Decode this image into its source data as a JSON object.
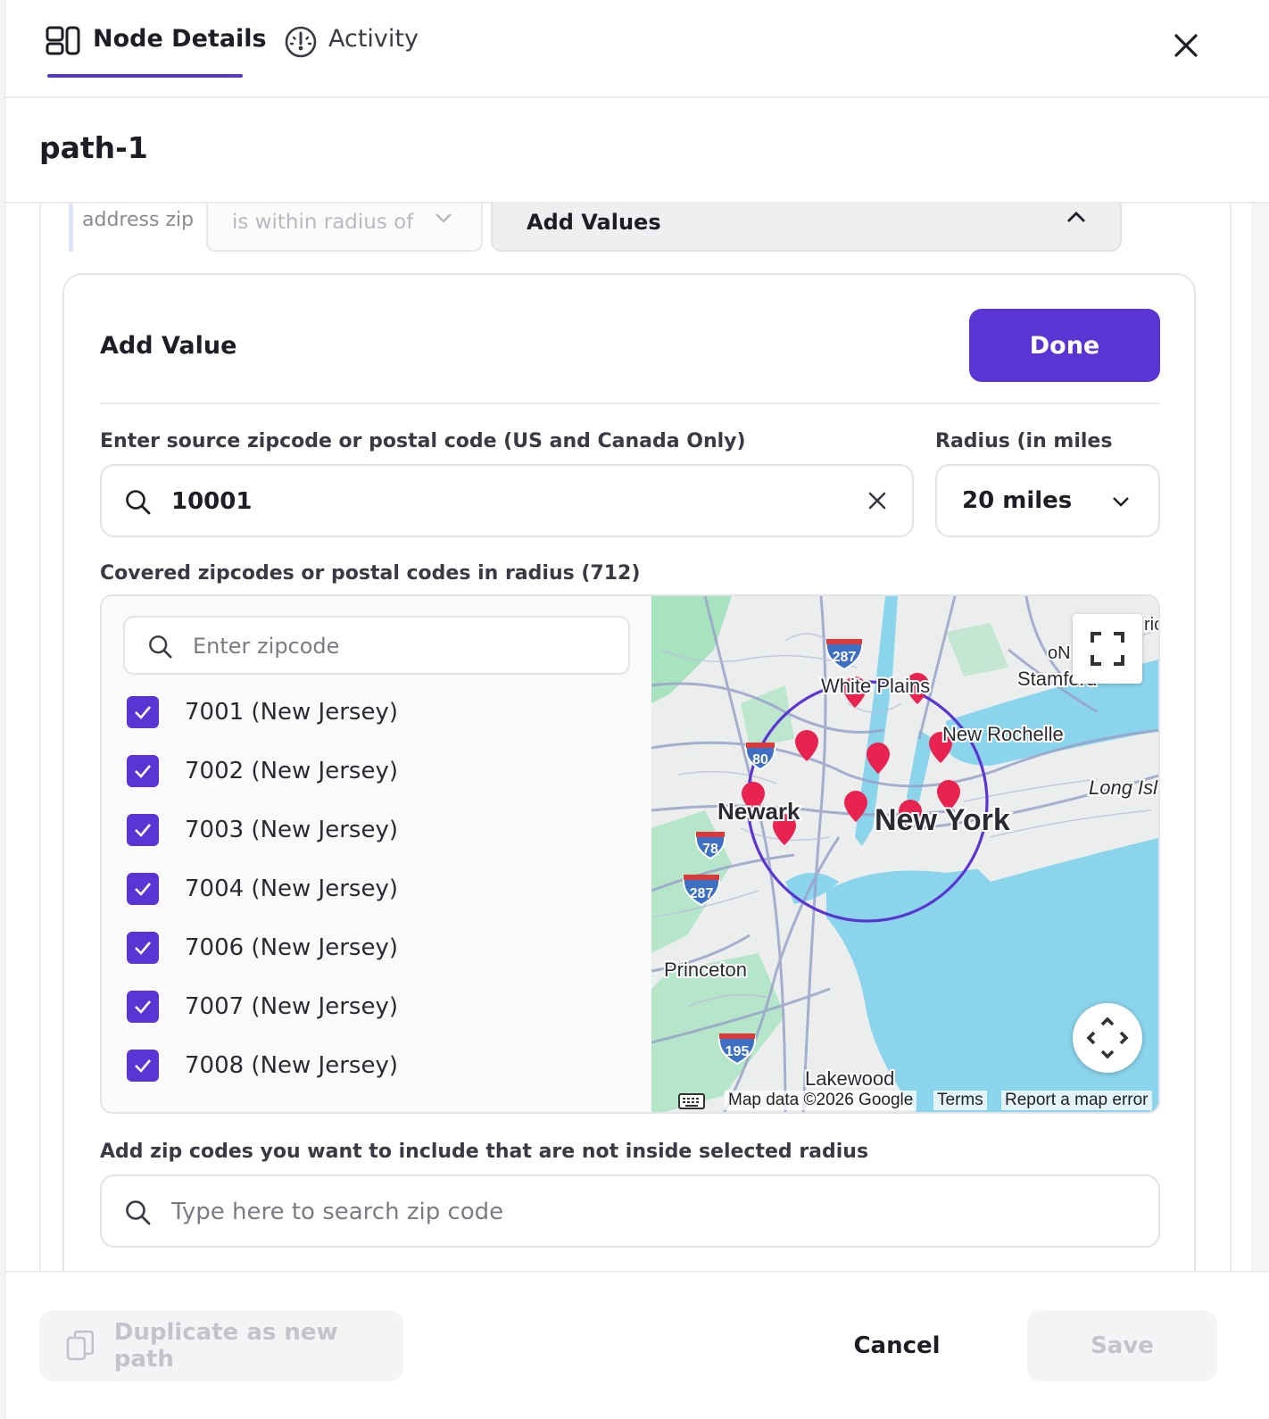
{
  "tabs": [
    {
      "label": "Node Details",
      "icon": "node-details-icon",
      "active": true
    },
    {
      "label": "Activity",
      "icon": "activity-icon",
      "active": false
    }
  ],
  "path_title": "path-1",
  "condition": {
    "field": "address zip",
    "operator": "is within radius of",
    "values_label": "Add Values"
  },
  "add_value": {
    "title": "Add Value",
    "done_label": "Done",
    "source_label": "Enter source zipcode or postal code (US and Canada Only)",
    "source_value": "10001",
    "radius_label": "Radius (in miles",
    "radius_value": "20 miles",
    "covered_label": "Covered zipcodes or postal codes in radius  (712)",
    "zip_search_placeholder": "Enter zipcode",
    "zipcodes": [
      {
        "label": "7001 (New Jersey)",
        "checked": true
      },
      {
        "label": "7002 (New Jersey)",
        "checked": true
      },
      {
        "label": "7003 (New Jersey)",
        "checked": true
      },
      {
        "label": "7004 (New Jersey)",
        "checked": true
      },
      {
        "label": "7006 (New Jersey)",
        "checked": true
      },
      {
        "label": "7007 (New Jersey)",
        "checked": true
      },
      {
        "label": "7008 (New Jersey)",
        "checked": true
      }
    ],
    "include_label": "Add zip codes you want to include that are not inside selected radius",
    "include_placeholder": "Type here to search zip code"
  },
  "map": {
    "places": {
      "new_york": "New York",
      "newark": "Newark",
      "white_plains": "White Plains",
      "new_rochelle": "New Rochelle",
      "stamford": "Stamford",
      "princeton": "Princeton",
      "lakewood": "Lakewood",
      "long_island": "Long Isl",
      "norwalk": "oN",
      "bridgeport": "ric"
    },
    "shields": {
      "i287_north": "287",
      "i80": "80",
      "i78": "78",
      "i287_south": "287",
      "i195": "195"
    },
    "attribution": "Map data ©2026 Google",
    "terms": "Terms",
    "report": "Report a map error",
    "water_color": "#8ad4ec",
    "park_color": "#9fe0b8",
    "road_color": "#9aa3c9",
    "radius_color": "#5b34d4",
    "marker_color": "#e8234f"
  },
  "footer": {
    "duplicate_label": "Duplicate as new path",
    "cancel_label": "Cancel",
    "save_label": "Save"
  },
  "colors": {
    "accent": "#5b34d4",
    "text": "#1d1d26",
    "muted": "#c3c3ca"
  }
}
